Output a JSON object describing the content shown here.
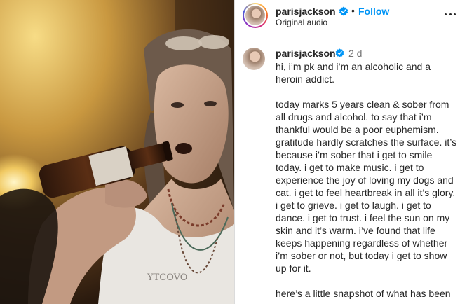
{
  "post": {
    "username": "parisjackson",
    "follow_label": "Follow",
    "separator": "•",
    "audio_label": "Original audio",
    "more_icon": "more-horizontal-icon"
  },
  "caption": {
    "username": "parisjackson",
    "time": "2 d",
    "text": "hi, i’m pk and i’m an alcoholic and a heroin addict.\n\ntoday marks 5 years clean & sober from all drugs and alcohol. to say that i’m thankful would be a poor euphemism. gratitude hardly scratches the surface. it’s because i’m sober that i get to smile today. i get to make music. i get to experience the joy of loving my dogs and cat. i get to feel heartbreak in all it’s glory. i get to grieve. i get to laugh. i get to dance. i get to trust. i feel the sun on my skin and it’s warm. i’ve found that life keeps happening regardless of whether i’m sober or not, but today i get to show up for it.\n\nhere’s a little snapshot of what has been"
  },
  "media": {
    "description_icon": "video-frame",
    "shirt_text": "YTCOVO"
  },
  "colors": {
    "follow": "#0095f6",
    "verified": "#0095f6",
    "text": "#262626",
    "muted": "#737373"
  }
}
